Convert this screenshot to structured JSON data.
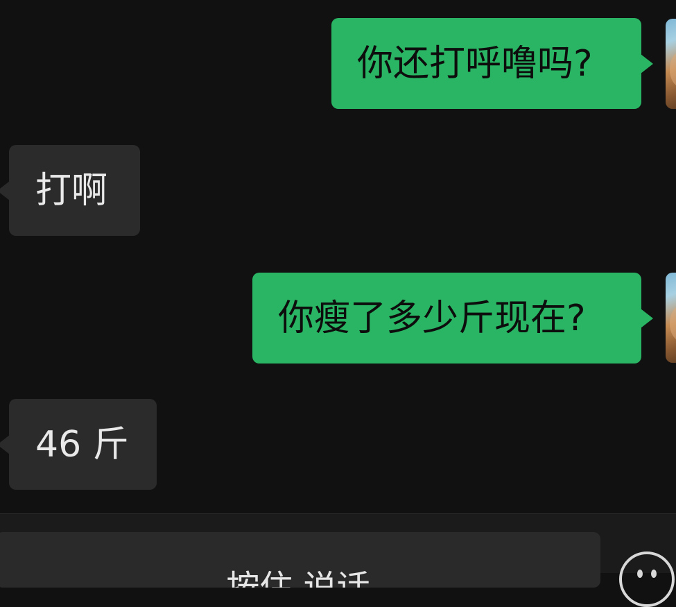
{
  "chat": {
    "messages": [
      {
        "side": "out",
        "text": "你还打呼噜吗?"
      },
      {
        "side": "in",
        "text": "打啊"
      },
      {
        "side": "out",
        "text": "你瘦了多少斤现在?"
      },
      {
        "side": "in",
        "text": "46 斤"
      }
    ]
  },
  "input_bar": {
    "draft_text": "按住 说话"
  },
  "colors": {
    "background": "#111111",
    "outgoing_bubble": "#29b563",
    "incoming_bubble": "#2b2b2b"
  }
}
